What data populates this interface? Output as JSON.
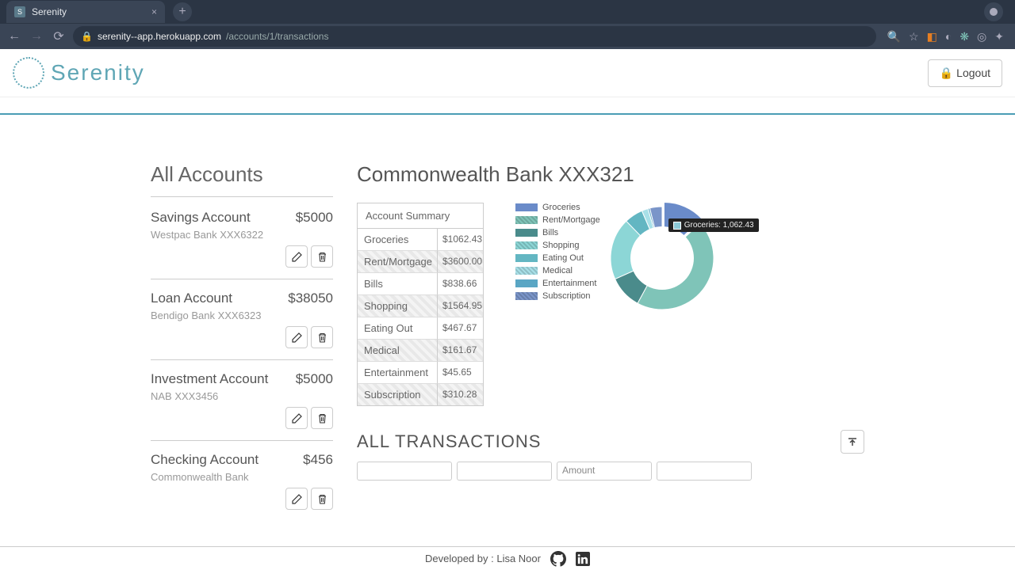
{
  "browser": {
    "tab_title": "Serenity",
    "url_host": "serenity--app.herokuapp.com",
    "url_path": "/accounts/1/transactions"
  },
  "header": {
    "brand": "Serenity",
    "logout_label": "Logout"
  },
  "sidebar": {
    "title": "All Accounts",
    "accounts": [
      {
        "name": "Savings Account",
        "balance": "$5000",
        "bank": "Westpac Bank XXX6322"
      },
      {
        "name": "Loan Account",
        "balance": "$38050",
        "bank": "Bendigo Bank XXX6323"
      },
      {
        "name": "Investment Account",
        "balance": "$5000",
        "bank": "NAB XXX3456"
      },
      {
        "name": "Checking Account",
        "balance": "$456",
        "bank": "Commonwealth Bank"
      }
    ]
  },
  "main": {
    "title": "Commonwealth Bank XXX321",
    "summary_header": "Account Summary",
    "summary": [
      {
        "category": "Groceries",
        "amount": "$1062.43"
      },
      {
        "category": "Rent/Mortgage",
        "amount": "$3600.00"
      },
      {
        "category": "Bills",
        "amount": "$838.66"
      },
      {
        "category": "Shopping",
        "amount": "$1564.95"
      },
      {
        "category": "Eating Out",
        "amount": "$467.67"
      },
      {
        "category": "Medical",
        "amount": "$161.67"
      },
      {
        "category": "Entertainment",
        "amount": "$45.65"
      },
      {
        "category": "Subscription",
        "amount": "$310.28"
      }
    ],
    "transactions_title": "ALL TRANSACTIONS",
    "filter_amount_label": "Amount"
  },
  "chart_data": {
    "type": "pie",
    "title": "Account Summary",
    "series": [
      {
        "name": "Groceries",
        "value": 1062.43,
        "color": "#6a8bc9"
      },
      {
        "name": "Rent/Mortgage",
        "value": 3600.0,
        "color": "#7fc4b8"
      },
      {
        "name": "Bills",
        "value": 838.66,
        "color": "#4a8b8b"
      },
      {
        "name": "Shopping",
        "value": 1564.95,
        "color": "#8cd6d6"
      },
      {
        "name": "Eating Out",
        "value": 467.67,
        "color": "#63b6c2"
      },
      {
        "name": "Medical",
        "value": 161.67,
        "color": "#a8e0e8"
      },
      {
        "name": "Entertainment",
        "value": 45.65,
        "color": "#5aa6c4"
      },
      {
        "name": "Subscription",
        "value": 310.28,
        "color": "#7a95c9"
      }
    ],
    "tooltip": {
      "label": "Groceries",
      "value": "1,062.43"
    }
  },
  "footer": {
    "text": "Developed by : Lisa Noor"
  }
}
